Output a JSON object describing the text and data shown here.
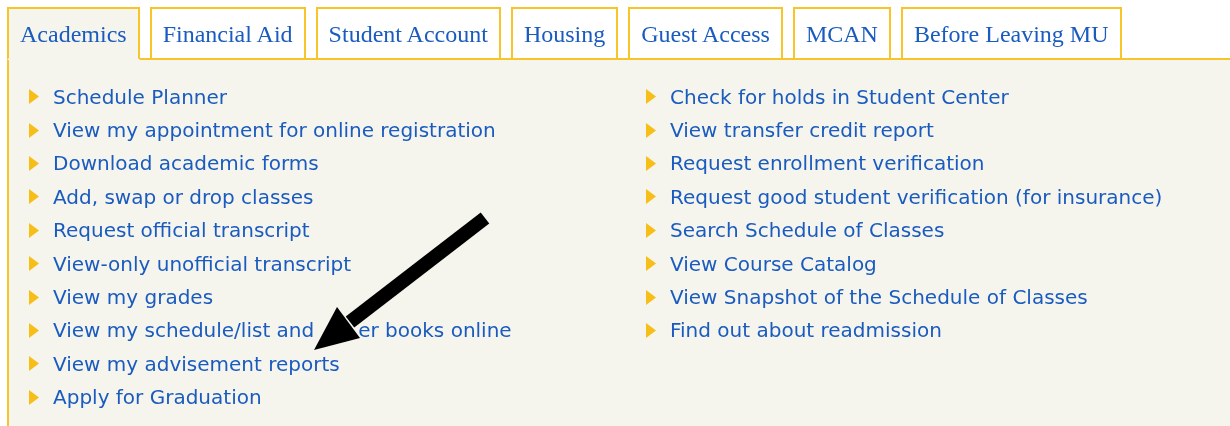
{
  "tabs": [
    {
      "label": "Academics",
      "selected": true
    },
    {
      "label": "Financial Aid",
      "selected": false
    },
    {
      "label": "Student Account",
      "selected": false
    },
    {
      "label": "Housing",
      "selected": false
    },
    {
      "label": "Guest Access",
      "selected": false
    },
    {
      "label": "MCAN",
      "selected": false
    },
    {
      "label": "Before Leaving MU",
      "selected": false
    }
  ],
  "columns": [
    {
      "links": [
        {
          "parts": [
            "Schedule Planner"
          ]
        },
        {
          "parts": [
            "View my appointment for online registration"
          ]
        },
        {
          "parts": [
            "Download academic forms"
          ]
        },
        {
          "parts": [
            "Add, swap or drop classes"
          ]
        },
        {
          "parts": [
            "Request official transcript"
          ]
        },
        {
          "parts": [
            "View-only unofficial transcript"
          ]
        },
        {
          "parts": [
            "View my grades"
          ]
        },
        {
          "parts": [
            "View my schedule/list and",
            "er books online"
          ]
        },
        {
          "parts": [
            "View my advisement reports"
          ]
        },
        {
          "parts": [
            "Apply for Graduation"
          ]
        }
      ]
    },
    {
      "links": [
        {
          "parts": [
            "Check for holds in Student Center"
          ]
        },
        {
          "parts": [
            "View transfer credit report"
          ]
        },
        {
          "parts": [
            "Request enrollment verification"
          ]
        },
        {
          "parts": [
            "Request good student verification (for insurance)"
          ]
        },
        {
          "parts": [
            "Search Schedule of Classes"
          ]
        },
        {
          "parts": [
            "View Course Catalog"
          ]
        },
        {
          "parts": [
            "View Snapshot of the Schedule of Classes"
          ]
        },
        {
          "parts": [
            "Find out about readmission"
          ]
        }
      ]
    }
  ]
}
